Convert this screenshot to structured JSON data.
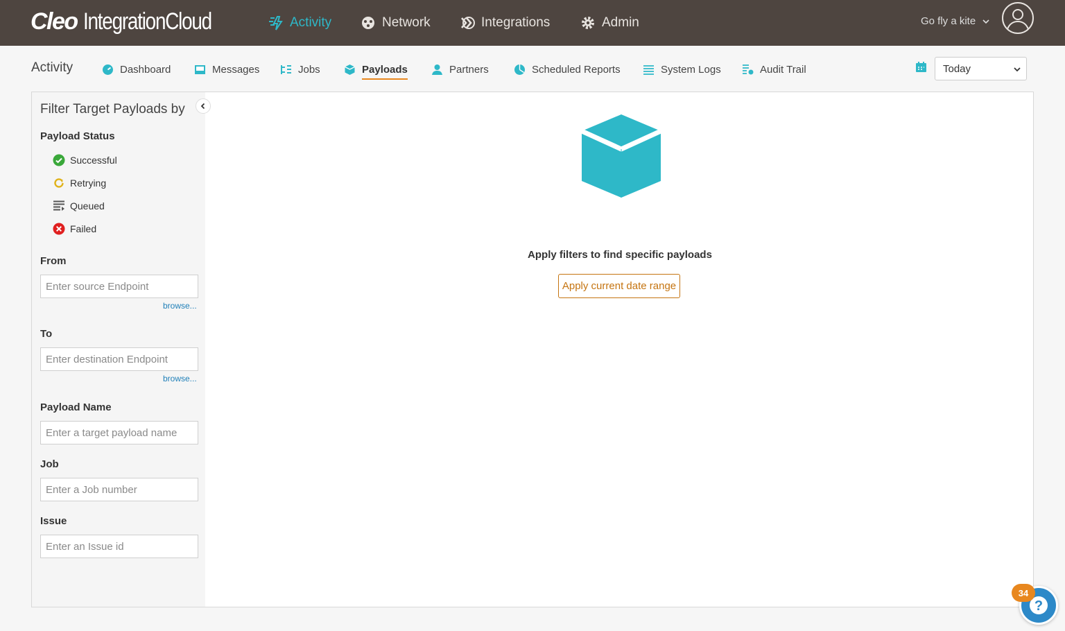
{
  "app": {
    "logo_bold": "Cleo",
    "logo_rest": "IntegrationCloud"
  },
  "topnav": [
    {
      "label": "Activity",
      "icon": "activity-icon",
      "active": true
    },
    {
      "label": "Network",
      "icon": "network-icon"
    },
    {
      "label": "Integrations",
      "icon": "integrations-icon"
    },
    {
      "label": "Admin",
      "icon": "gear-icon"
    }
  ],
  "user": {
    "name": "Go fly a kite"
  },
  "section": {
    "title": "Activity"
  },
  "subnav": [
    {
      "label": "Dashboard",
      "icon": "dashboard-icon"
    },
    {
      "label": "Messages",
      "icon": "messages-icon"
    },
    {
      "label": "Jobs",
      "icon": "jobs-icon"
    },
    {
      "label": "Payloads",
      "icon": "payloads-icon",
      "active": true
    },
    {
      "label": "Partners",
      "icon": "partners-icon"
    },
    {
      "label": "Scheduled Reports",
      "icon": "pie-chart-icon"
    },
    {
      "label": "System Logs",
      "icon": "list-icon"
    },
    {
      "label": "Audit Trail",
      "icon": "audit-icon"
    }
  ],
  "date_range": {
    "selected": "Today"
  },
  "filter": {
    "title": "Filter Target Payloads by",
    "status_label": "Payload Status",
    "statuses": [
      {
        "label": "Successful",
        "icon": "check-circle-icon",
        "color": "#3aa83a"
      },
      {
        "label": "Retrying",
        "icon": "retry-icon",
        "color": "#e0b21a"
      },
      {
        "label": "Queued",
        "icon": "queue-icon",
        "color": "#555555"
      },
      {
        "label": "Failed",
        "icon": "x-circle-icon",
        "color": "#e02020"
      }
    ],
    "from_label": "From",
    "from_placeholder": "Enter source Endpoint",
    "browse": "browse...",
    "to_label": "To",
    "to_placeholder": "Enter destination Endpoint",
    "payload_name_label": "Payload Name",
    "payload_name_placeholder": "Enter a target payload name",
    "job_label": "Job",
    "job_placeholder": "Enter a Job number",
    "issue_label": "Issue",
    "issue_placeholder": "Enter an Issue id"
  },
  "main": {
    "empty_message": "Apply filters to find specific payloads",
    "apply_button": "Apply current date range"
  },
  "help": {
    "badge_count": "34"
  },
  "colors": {
    "header_bg": "#4e4540",
    "accent_teal": "#2eb8c8",
    "accent_orange": "#e8871e"
  }
}
